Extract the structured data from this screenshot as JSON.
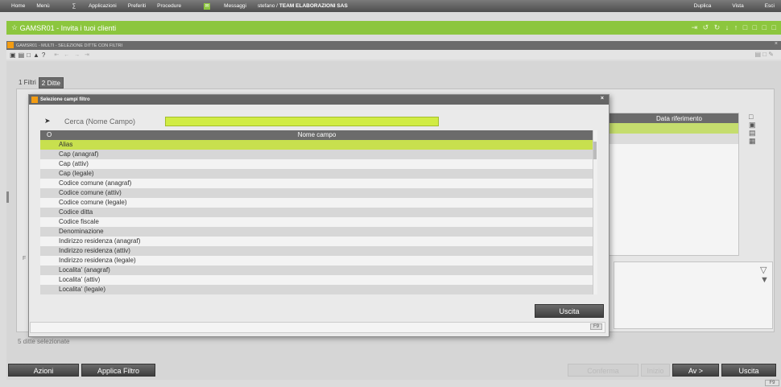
{
  "topbar": {
    "items": [
      "Home",
      "Menù",
      "Applicazioni",
      "Preferiti",
      "Procedure"
    ],
    "messages_label": "Messaggi",
    "user": "stefano /",
    "company": "TEAM ELABORAZIONI SAS",
    "right_items": [
      "Duplica",
      "Vista",
      "Esci"
    ]
  },
  "window": {
    "title": "GAMSR01 - Invita i tuoi clienti",
    "controls": "⇥ ↺ ↻ ↓ ↑ □ □ □ □",
    "subtitle": "GAMSR01 - MULTI - SELEZIONE DITTE CON FILTRI"
  },
  "tabs": [
    "1 Filtri",
    "2 Ditte"
  ],
  "grid": {
    "column_header": "Data riferimento"
  },
  "status_text": "5 ditte selezionate",
  "tiny_label": "F",
  "bottom": {
    "buttons": [
      "Azioni",
      "Applica Filtro"
    ],
    "right_buttons": [
      "Conferma",
      "Inizio",
      "Av >",
      "Uscita"
    ],
    "f9": "F9"
  },
  "modal": {
    "title": "Selezione campi filtro",
    "search_label": "Cerca (Nome Campo)",
    "search_value": "",
    "list_header_o": "O",
    "list_header": "Nome campo",
    "items": [
      "Alias",
      "Cap (anagraf)",
      "Cap (attiv)",
      "Cap (legale)",
      "Codice comune (anagraf)",
      "Codice comune (attiv)",
      "Codice comune (legale)",
      "Codice ditta",
      "Codice fiscale",
      "Denominazione",
      "Indirizzo residenza (anagraf)",
      "Indirizzo residenza (attiv)",
      "Indirizzo residenza (legale)",
      "Localita' (anagraf)",
      "Localita' (attiv)",
      "Localita' (legale)"
    ],
    "uscita_label": "Uscita",
    "f9": "F9"
  }
}
